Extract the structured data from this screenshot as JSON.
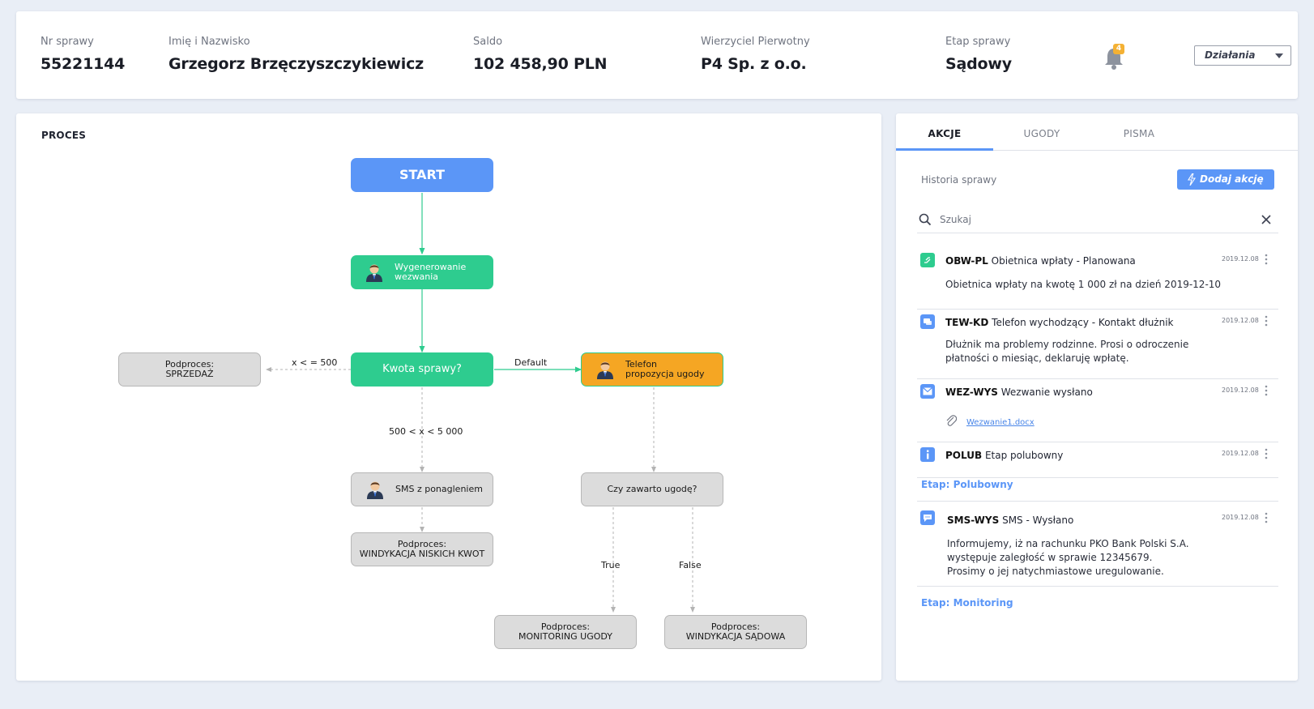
{
  "header": {
    "case_no_label": "Nr sprawy",
    "case_no": "55221144",
    "name_label": "Imię i Nazwisko",
    "name": "Grzegorz Brzęczyszczykiewicz",
    "balance_label": "Saldo",
    "balance": "102 458,90 PLN",
    "creditor_label": "Wierzyciel Pierwotny",
    "creditor": "P4 Sp. z o.o.",
    "stage_label": "Etap sprawy",
    "stage": "Sądowy",
    "notifications_count": "4",
    "actions_label": "Działania"
  },
  "process": {
    "title": "PROCES",
    "nodes": {
      "start": "START",
      "generate": "Wygenerowanie\nwezwania",
      "amount": "Kwota sprawy?",
      "phone": "Telefon\npropozycja ugody",
      "sale": "Podproces:\nSPRZEDAŻ",
      "sms": "SMS z ponagleniem",
      "low_recovery": "Podproces:\nWINDYKACJA NISKICH KWOT",
      "agreement_q": "Czy zawarto ugodę?",
      "monitoring": "Podproces:\nMONITORING UGODY",
      "court": "Podproces:\nWINDYKACJA SĄDOWA"
    },
    "edges": {
      "le500": "x < = 500",
      "default": "Default",
      "mid": "500 < x < 5 000",
      "true": "True",
      "false": "False"
    }
  },
  "right_panel": {
    "tabs": [
      "AKCJE",
      "UGODY",
      "PISMA"
    ],
    "history_label": "Historia sprawy",
    "add_action_label": "Dodaj akcję",
    "search_placeholder": "Szukaj",
    "entries": [
      {
        "code": "OBW-PL",
        "title": "Obietnica wpłaty - Planowana",
        "date": "2019.12.08",
        "body": "Obietnica wpłaty na kwotę 1 000 zł na dzień 2019-12-10",
        "icon": "promise-icon",
        "color": "#2ecc8f"
      },
      {
        "code": "TEW-KD",
        "title": "Telefon wychodzący - Kontakt dłużnik",
        "date": "2019.12.08",
        "body": "Dłużnik ma problemy rodzinne. Prosi o odroczenie płatności o miesiąc, deklaruję wpłatę.",
        "icon": "chat-icon",
        "color": "#5b96f7"
      },
      {
        "code": "WEZ-WYS",
        "title": "Wezwanie wysłano",
        "date": "2019.12.08",
        "attachment": "Wezwanie1.docx",
        "icon": "envelope-icon",
        "color": "#5b96f7"
      },
      {
        "code": "POLUB",
        "title": "Etap polubowny",
        "date": "2019.12.08",
        "icon": "info-icon",
        "color": "#5b96f7"
      },
      {
        "code": "SMS-WYS",
        "title": "SMS - Wysłano",
        "date": "2019.12.08",
        "body": "Informujemy, iż na rachunku PKO Bank Polski S.A. występuje zaległość w sprawie 12345679. Prosimy o jej natychmiastowe uregulowanie.",
        "icon": "sms-icon",
        "color": "#5b96f7"
      }
    ],
    "stage_polubowny": "Etap: Polubowny",
    "stage_monitoring": "Etap: Monitoring"
  }
}
